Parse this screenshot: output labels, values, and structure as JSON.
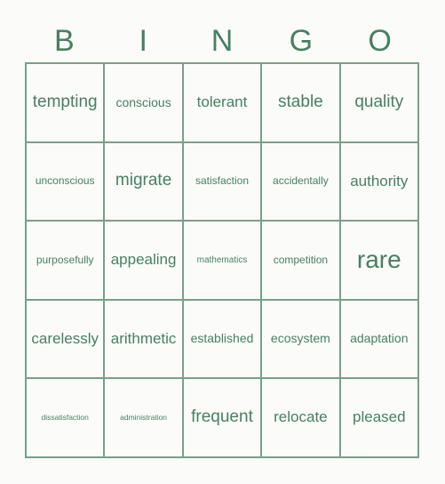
{
  "card": {
    "header": {
      "letters": [
        "B",
        "I",
        "N",
        "G",
        "O"
      ]
    },
    "grid": {
      "rows": 5,
      "columns": 5,
      "cells": [
        {
          "text": "tempting",
          "size": "s-lg"
        },
        {
          "text": "conscious",
          "size": "s-sm"
        },
        {
          "text": "tolerant",
          "size": "s-md"
        },
        {
          "text": "stable",
          "size": "s-lg"
        },
        {
          "text": "quality",
          "size": "s-lg"
        },
        {
          "text": "unconscious",
          "size": "s-xs"
        },
        {
          "text": "migrate",
          "size": "s-lg"
        },
        {
          "text": "satisfaction",
          "size": "s-xs"
        },
        {
          "text": "accidentally",
          "size": "s-xs"
        },
        {
          "text": "authority",
          "size": "s-md"
        },
        {
          "text": "purposefully",
          "size": "s-xs"
        },
        {
          "text": "appealing",
          "size": "s-md"
        },
        {
          "text": "mathematics",
          "size": "s-xxs"
        },
        {
          "text": "competition",
          "size": "s-xs"
        },
        {
          "text": "rare",
          "size": "s-xl"
        },
        {
          "text": "carelessly",
          "size": "s-md"
        },
        {
          "text": "arithmetic",
          "size": "s-md"
        },
        {
          "text": "established",
          "size": "s-sm"
        },
        {
          "text": "ecosystem",
          "size": "s-sm"
        },
        {
          "text": "adaptation",
          "size": "s-sm"
        },
        {
          "text": "dissatisfaction",
          "size": "s-tiny"
        },
        {
          "text": "administration",
          "size": "s-tiny"
        },
        {
          "text": "frequent",
          "size": "s-lg"
        },
        {
          "text": "relocate",
          "size": "s-md"
        },
        {
          "text": "pleased",
          "size": "s-md"
        }
      ]
    },
    "colors": {
      "text": "#478061",
      "border": "#7a9f88",
      "background": "#fbfbfa"
    }
  }
}
